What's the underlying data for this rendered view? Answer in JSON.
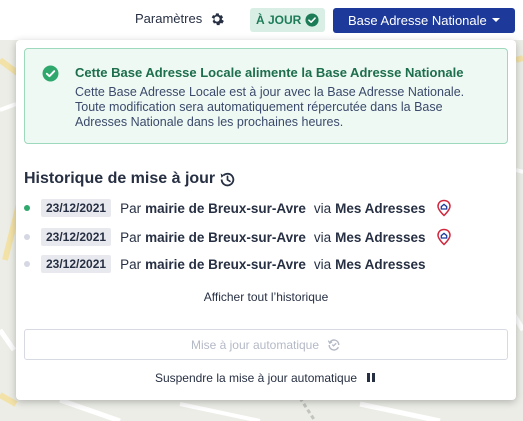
{
  "header": {
    "params_label": "Paramètres",
    "params_icon": "gear-icon",
    "status_label": "À JOUR",
    "status_icon": "check-circle-icon",
    "ban_button_label": "Base Adresse Nationale",
    "ban_button_icon": "caret-down-icon"
  },
  "alert": {
    "title": "Cette Base Adresse Locale alimente la Base Adresse Nationale",
    "body": "Cette Base Adresse Locale est à jour avec la Base Adresse Nationale. Toute modification sera automatiquement répercutée dans la Base Adresses Nationale dans les prochaines heures."
  },
  "history": {
    "title": "Historique de mise à jour",
    "items": [
      {
        "date": "23/12/2021",
        "by_prefix": "Par",
        "author": "mairie de Breux-sur-Avre",
        "via_prefix": "via",
        "tool": "Mes Adresses",
        "has_pin": true,
        "active": true
      },
      {
        "date": "23/12/2021",
        "by_prefix": "Par",
        "author": "mairie de Breux-sur-Avre",
        "via_prefix": "via",
        "tool": "Mes Adresses",
        "has_pin": true,
        "active": false
      },
      {
        "date": "23/12/2021",
        "by_prefix": "Par",
        "author": "mairie de Breux-sur-Avre",
        "via_prefix": "via",
        "tool": "Mes Adresses",
        "has_pin": false,
        "active": false
      }
    ],
    "show_all_label": "Afficher tout l’historique"
  },
  "auto_update": {
    "button_label": "Mise à jour automatique",
    "suspend_label": "Suspendre la mise à jour automatique"
  },
  "colors": {
    "primary": "#1d3a9a",
    "success": "#1d7c58",
    "success_bg": "#d9efe6",
    "alert_bg": "#eef9f4",
    "alert_border": "#9ed8bd",
    "pin_red": "#d0273d"
  }
}
